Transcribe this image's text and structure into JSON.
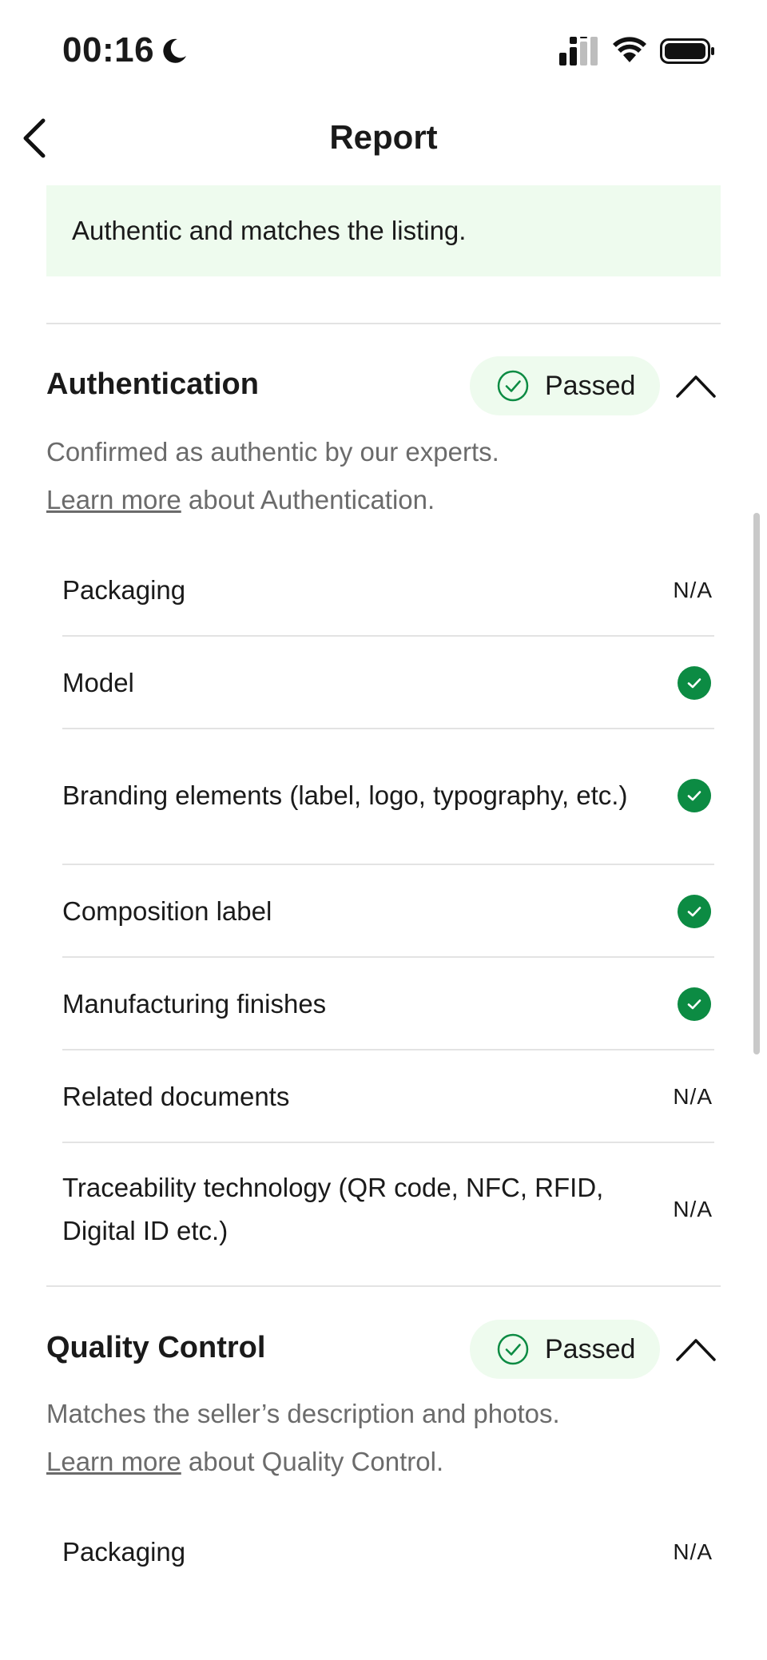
{
  "status_bar": {
    "time": "00:16",
    "icons": [
      "moon-icon",
      "signal-icon",
      "wifi-icon",
      "battery-icon"
    ]
  },
  "nav": {
    "title": "Report",
    "back_icon": "chevron-left-icon"
  },
  "summary": {
    "text": "Authentic and matches the listing."
  },
  "authentication": {
    "title": "Authentication",
    "status": "Passed",
    "description": "Confirmed as authentic by our experts.",
    "learn_more": "Learn more",
    "learn_more_suffix": " about Authentication.",
    "items": [
      {
        "label": "Packaging",
        "result": "N/A"
      },
      {
        "label": "Model",
        "result": "check"
      },
      {
        "label": "Branding elements (label, logo, typography, etc.)",
        "result": "check"
      },
      {
        "label": "Composition label",
        "result": "check"
      },
      {
        "label": "Manufacturing finishes",
        "result": "check"
      },
      {
        "label": "Related documents",
        "result": "N/A"
      },
      {
        "label": "Traceability technology (QR code, NFC, RFID, Digital ID etc.)",
        "result": "N/A"
      }
    ]
  },
  "quality_control": {
    "title": "Quality Control",
    "status": "Passed",
    "description": "Matches the seller’s description and photos.",
    "learn_more": "Learn more",
    "learn_more_suffix": " about Quality Control.",
    "items": [
      {
        "label": "Packaging",
        "result": "N/A"
      }
    ]
  },
  "colors": {
    "accent_green": "#0c8b43",
    "banner_bg": "#eefbee"
  }
}
